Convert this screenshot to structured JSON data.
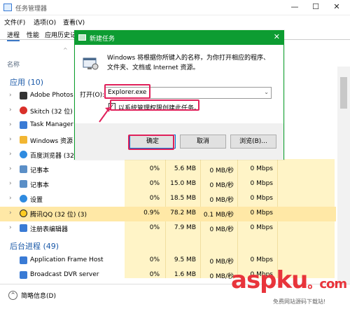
{
  "window": {
    "title": "任务管理器"
  },
  "menu": {
    "file": "文件(F)",
    "options": "选项(O)",
    "view": "查看(V)"
  },
  "tabs": {
    "processes": "进程",
    "performance": "性能",
    "app_history": "应用历史记"
  },
  "columns": {
    "name": "名称"
  },
  "apps_group": "应用 (10)",
  "bg_group": "后台进程 (49)",
  "app_rows": [
    {
      "name": "Adobe Photos",
      "color": "#333333"
    },
    {
      "name": "Skitch (32 位)",
      "color": "#d9302a"
    },
    {
      "name": "Task Manager",
      "color": "#3a7bd5"
    },
    {
      "name": "Windows 资源",
      "color": "#f2b632"
    },
    {
      "name": "百度浏览器 (32",
      "color": "#2f8be0"
    }
  ],
  "detail_rows": [
    {
      "name": "记事本",
      "color": "#5b8fc7",
      "cpu": "0%",
      "mem": "5.6 MB",
      "disk": "0 MB/秒",
      "net": "0 Mbps"
    },
    {
      "name": "记事本",
      "color": "#5b8fc7",
      "cpu": "0%",
      "mem": "15.0 MB",
      "disk": "0 MB/秒",
      "net": "0 Mbps"
    },
    {
      "name": "设置",
      "color": "#2f8be0",
      "cpu": "0%",
      "mem": "18.5 MB",
      "disk": "0 MB/秒",
      "net": "0 Mbps"
    },
    {
      "name": "腾讯QQ (32 位) (3)",
      "color": "#ffcc22",
      "cpu": "0.9%",
      "mem": "78.2 MB",
      "disk": "0.1 MB/秒",
      "net": "0 Mbps"
    },
    {
      "name": "注册表编辑器",
      "color": "#3a7bd5",
      "cpu": "0%",
      "mem": "7.9 MB",
      "disk": "0 MB/秒",
      "net": "0 Mbps"
    }
  ],
  "bg_rows": [
    {
      "name": "Application Frame Host",
      "color": "#3a7bd5",
      "cpu": "0%",
      "mem": "9.5 MB",
      "disk": "0 MB/秒",
      "net": "0 Mbps"
    },
    {
      "name": "Broadcast DVR server",
      "color": "#3a7bd5",
      "cpu": "0%",
      "mem": "1.6 MB",
      "disk": "0 MB/秒",
      "net": "0 Mbps"
    }
  ],
  "footer": {
    "less_details": "简略信息(D)"
  },
  "dialog": {
    "title": "新建任务",
    "description": "Windows 将根据你所键入的名称，为你打开相应的程序、文件夹、文档或 Internet 资源。",
    "open_label": "打开(O):",
    "open_value": "Explorer.exe",
    "admin_label": "以系统管理权限创建此任务。",
    "ok": "确定",
    "cancel": "取消",
    "browse": "浏览(B)..."
  },
  "watermark": {
    "logo": "aspku",
    "suffix": "。com",
    "tagline": "免费网站源码下载站!"
  },
  "colors": {
    "dialog_title": "#0d9c32",
    "highlight": "#e0205a",
    "group_title": "#1a59a8",
    "heat": "#fff4c7"
  }
}
